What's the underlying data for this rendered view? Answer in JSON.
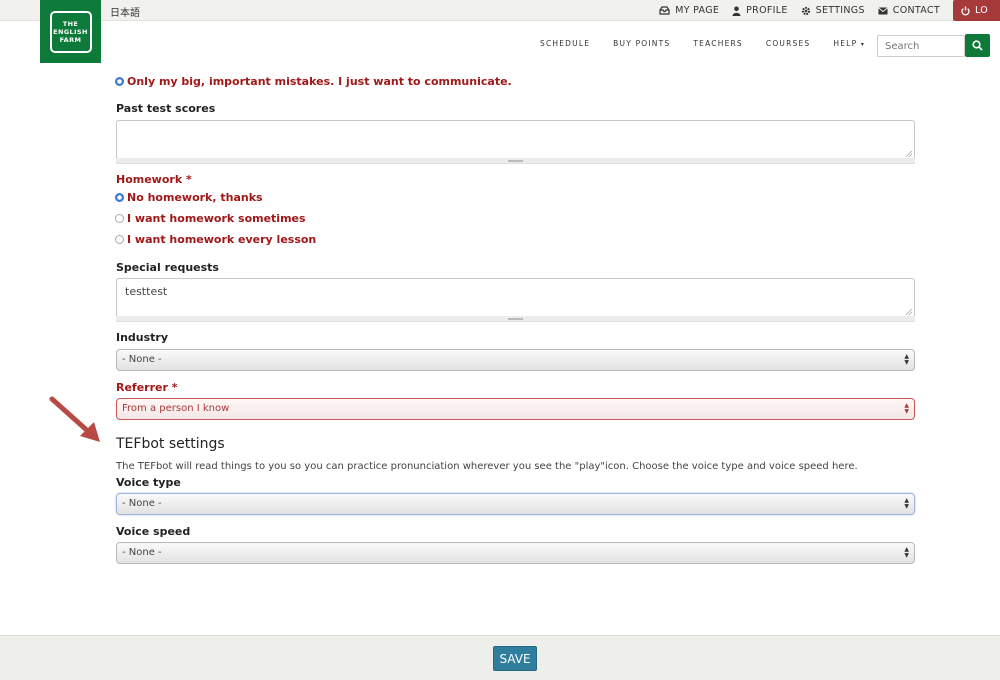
{
  "topbar": {
    "language": "日本語",
    "links": [
      {
        "label": "MY PAGE",
        "icon": "inbox-icon"
      },
      {
        "label": "PROFILE",
        "icon": "user-icon"
      },
      {
        "label": "SETTINGS",
        "icon": "gear-icon"
      },
      {
        "label": "CONTACT",
        "icon": "envelope-icon"
      }
    ],
    "logout_label": "LO"
  },
  "logo": {
    "text": "THE\nENGLISH\nFARM"
  },
  "nav": {
    "items": [
      "SCHEDULE",
      "BUY POINTS",
      "TEACHERS",
      "COURSES",
      "HELP"
    ],
    "search_placeholder": "Search"
  },
  "form": {
    "correction_selected": "Only my big, important mistakes. I just want to communicate.",
    "past_scores_label": "Past test scores",
    "past_scores_value": "",
    "homework_label": "Homework *",
    "homework_options": [
      "No homework, thanks",
      "I want homework sometimes",
      "I want homework every lesson"
    ],
    "special_requests_label": "Special requests",
    "special_requests_value": "testtest",
    "industry_label": "Industry",
    "industry_value": "- None -",
    "referrer_label": "Referrer *",
    "referrer_value": "From a person I know",
    "tefbot_title": "TEFbot settings",
    "tefbot_help": "The TEFbot will read things to you so you can practice pronunciation wherever you see the \"play\"icon. Choose the voice type and voice speed here.",
    "voice_type_label": "Voice type",
    "voice_type_value": "- None -",
    "voice_speed_label": "Voice speed",
    "voice_speed_value": "- None -"
  },
  "footer": {
    "save_label": "SAVE"
  },
  "colors": {
    "brand_green": "#0e7a3a",
    "required_red": "#a01818",
    "save_blue": "#2f7e9e",
    "logout_red": "#a63a3a"
  }
}
